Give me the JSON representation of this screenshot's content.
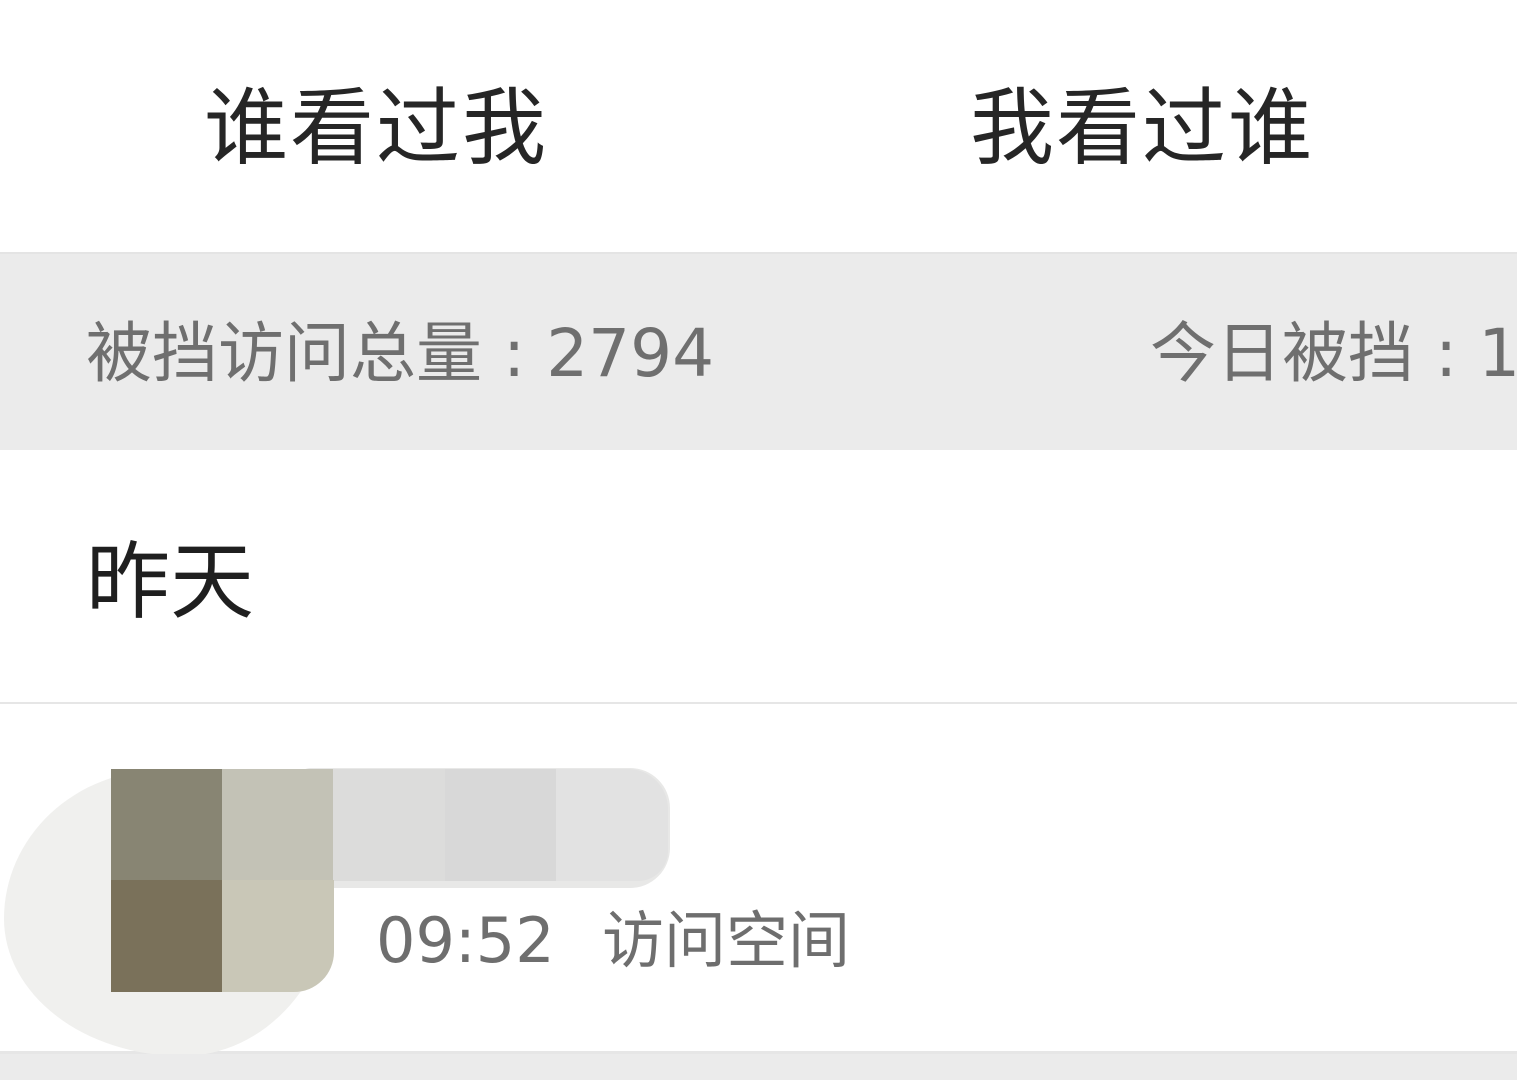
{
  "tabs": {
    "left_label": "谁看过我",
    "right_label": "我看过谁"
  },
  "stats": {
    "total_blocked": "被挡访问总量 : 2794",
    "today_blocked": "今日被挡 : 1"
  },
  "section": {
    "title": "昨天"
  },
  "visitor": {
    "time": "09:52",
    "action": "访问空间"
  },
  "colors": {
    "stats_background": "#ebebeb",
    "tab_text": "#262626",
    "secondary_text": "#6e6e6e",
    "avatar_mosaic": [
      "#888573",
      "#c3c2b6",
      "#dcdcdb",
      "#d8d8d8",
      "#e2e2e2",
      "#7a715a",
      "#c9c7b7"
    ]
  }
}
